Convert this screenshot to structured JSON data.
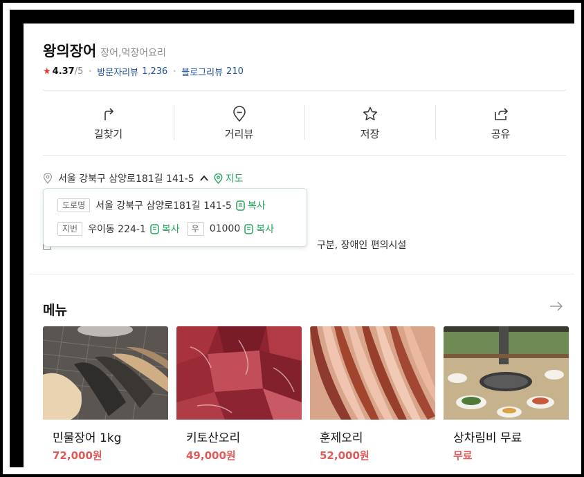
{
  "place": {
    "name": "왕의장어",
    "category": "장어,먹장어요리",
    "rating": "4.37",
    "rating_max": "/5",
    "visitor_review_label": "방문자리뷰",
    "visitor_review_count": "1,236",
    "blog_review_label": "블로그리뷰",
    "blog_review_count": "210"
  },
  "actions": [
    {
      "label": "길찾기",
      "icon": "directions-icon"
    },
    {
      "label": "거리뷰",
      "icon": "streetview-pin-icon"
    },
    {
      "label": "저장",
      "icon": "star-icon"
    },
    {
      "label": "공유",
      "icon": "share-icon"
    }
  ],
  "address": {
    "text": "서울 강북구 삼양로181길 141-5",
    "map_label": "지도",
    "road_tag": "도로명",
    "road_address": "서울 강북구 삼양로181길 141-5",
    "lot_tag": "지번",
    "lot_address": "우이동 224-1",
    "zip_tag": "우",
    "zip": "01000",
    "copy_label": "복사"
  },
  "facilities_partial": "구분, 장애인 편의시설",
  "menu": {
    "title": "메뉴",
    "items": [
      {
        "name": "민물장어 1kg",
        "price": "72,000원"
      },
      {
        "name": "키토산오리",
        "price": "49,000원"
      },
      {
        "name": "훈제오리",
        "price": "52,000원"
      },
      {
        "name": "상차림비 무료",
        "price": "무료"
      }
    ]
  },
  "colors": {
    "accent_green": "#23a55a",
    "link_blue": "#1d4e9e",
    "price_red": "#e05a5a",
    "star_red": "#e53935"
  }
}
